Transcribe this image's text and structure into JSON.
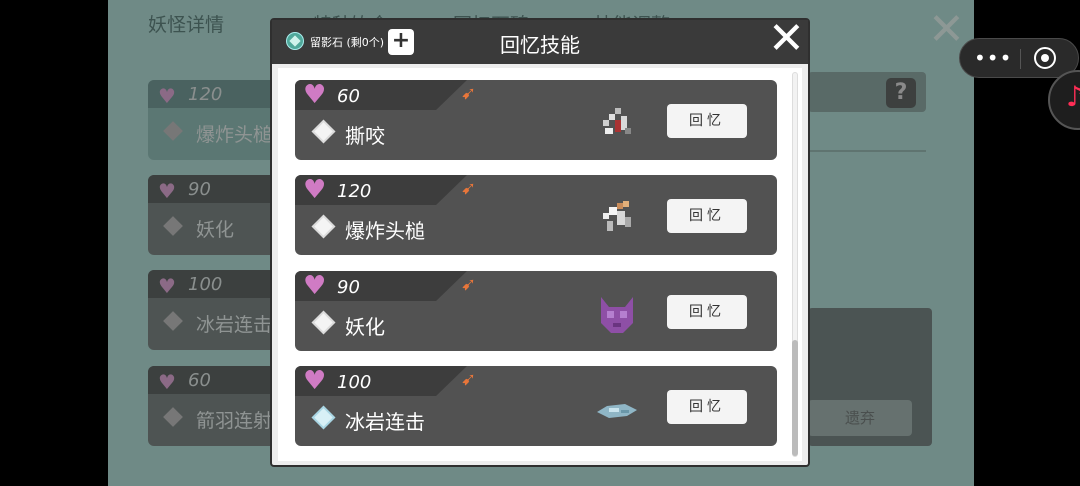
{
  "background": {
    "tabs": [
      "妖怪详情",
      "特种饮食",
      "回忆石碑",
      "技能调整"
    ],
    "skills": [
      {
        "cost": "120",
        "name": "爆炸头槌",
        "selected": true
      },
      {
        "cost": "90",
        "name": "妖化",
        "selected": false
      },
      {
        "cost": "100",
        "name": "冰岩连击",
        "selected": false
      },
      {
        "cost": "60",
        "name": "箭羽连射",
        "selected": false
      }
    ],
    "discard_label": "遗弃",
    "help_label": "?"
  },
  "controls": {
    "menu_dots": "•••"
  },
  "modal": {
    "title": "回忆技能",
    "stone_label": "留影石 (剩0个)",
    "plus_label": "+",
    "close_label": "✕",
    "recall_label": "回忆",
    "skills": [
      {
        "cost": "60",
        "name": "撕咬",
        "icon": "bite-icon"
      },
      {
        "cost": "120",
        "name": "爆炸头槌",
        "icon": "explosive-headbutt-icon"
      },
      {
        "cost": "90",
        "name": "妖化",
        "icon": "demonize-mask-icon"
      },
      {
        "cost": "100",
        "name": "冰岩连击",
        "icon": "ice-rock-icon"
      }
    ]
  },
  "colors": {
    "heart": "#d07bc4",
    "card": "#525252",
    "header": "#3a3a3a",
    "arrow": "#e8763a"
  }
}
